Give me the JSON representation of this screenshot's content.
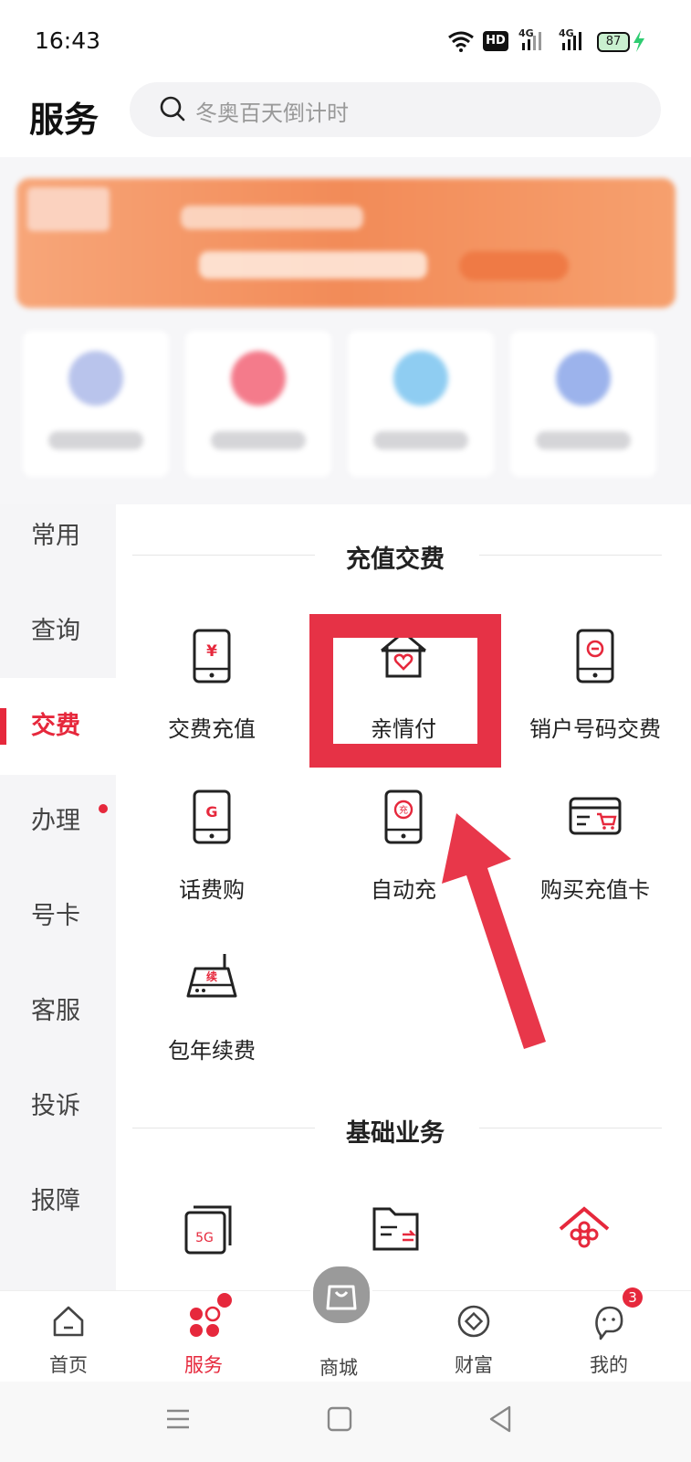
{
  "status_bar": {
    "time": "16:43",
    "hd_label": "HD",
    "net1": "4G",
    "net2": "4G",
    "battery": "87"
  },
  "header": {
    "title": "服务",
    "search_placeholder": "冬奥百天倒计时"
  },
  "sidebar": {
    "items": [
      {
        "label": "常用"
      },
      {
        "label": "查询"
      },
      {
        "label": "交费"
      },
      {
        "label": "办理"
      },
      {
        "label": "号卡"
      },
      {
        "label": "客服"
      },
      {
        "label": "投诉"
      },
      {
        "label": "报障"
      }
    ],
    "active_index": 2
  },
  "sections": {
    "recharge": {
      "title": "充值交费",
      "items": [
        {
          "label": "交费充值",
          "icon": "phone-yen-icon"
        },
        {
          "label": "亲情付",
          "icon": "house-heart-icon"
        },
        {
          "label": "销户号码交费",
          "icon": "phone-minus-icon"
        },
        {
          "label": "话费购",
          "icon": "phone-g-icon"
        },
        {
          "label": "自动充",
          "icon": "phone-recharge-icon"
        },
        {
          "label": "购买充值卡",
          "icon": "card-cart-icon"
        },
        {
          "label": "包年续费",
          "icon": "router-renew-icon",
          "icon_text": "续"
        }
      ],
      "icon_text": {
        "yen": "¥",
        "g": "G",
        "recharge": "充"
      }
    },
    "basic": {
      "title": "基础业务",
      "icon_text": {
        "fiveg": "5G"
      }
    }
  },
  "bottom_nav": {
    "items": [
      {
        "label": "首页",
        "icon": "home-icon"
      },
      {
        "label": "服务",
        "icon": "service-icon"
      },
      {
        "label": "商城",
        "icon": "shopping-bag-icon"
      },
      {
        "label": "财富",
        "icon": "wealth-icon"
      },
      {
        "label": "我的",
        "icon": "profile-icon"
      }
    ],
    "active_index": 1,
    "profile_badge": "3"
  },
  "colors": {
    "accent": "#e6283c",
    "highlight": "#e63246",
    "arrow": "#e8374a"
  }
}
